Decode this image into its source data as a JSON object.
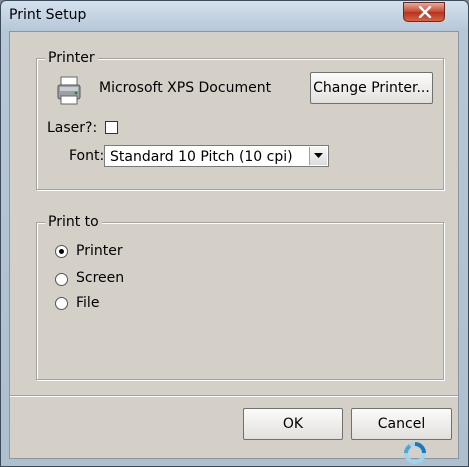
{
  "window": {
    "title": "Print Setup"
  },
  "printer_group": {
    "legend": "Printer",
    "printer_name": "Microsoft XPS Document",
    "change_printer_label": "Change Printer...",
    "laser_label": "Laser?:",
    "laser_checked": false,
    "font_label": "Font:",
    "font_selected": "Standard 10 Pitch (10 cpi)"
  },
  "print_to_group": {
    "legend": "Print to",
    "options": [
      {
        "label": "Printer",
        "selected": true
      },
      {
        "label": "Screen",
        "selected": false
      },
      {
        "label": "File",
        "selected": false
      }
    ]
  },
  "buttons": {
    "ok_label": "OK",
    "cancel_label": "Cancel"
  },
  "icons": {
    "close": "close-icon",
    "printer": "printer-icon",
    "dropdown": "chevron-down-icon",
    "busy": "busy-cursor-icon"
  },
  "colors": {
    "dialog_bg": "#d4d0c8",
    "close_button": "#c8452b"
  }
}
